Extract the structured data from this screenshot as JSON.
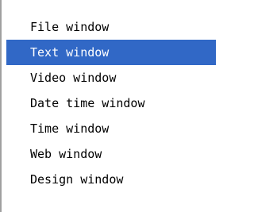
{
  "menu": {
    "items": [
      {
        "label": "File window",
        "selected": false
      },
      {
        "label": "Text window",
        "selected": true
      },
      {
        "label": "Video window",
        "selected": false
      },
      {
        "label": "Date time window",
        "selected": false
      },
      {
        "label": "Time window",
        "selected": false
      },
      {
        "label": "Web window",
        "selected": false
      },
      {
        "label": "Design window",
        "selected": false
      }
    ],
    "colors": {
      "selection_background": "#3168c6",
      "selection_text": "#ffffff",
      "text": "#000000",
      "background": "#ffffff"
    }
  }
}
